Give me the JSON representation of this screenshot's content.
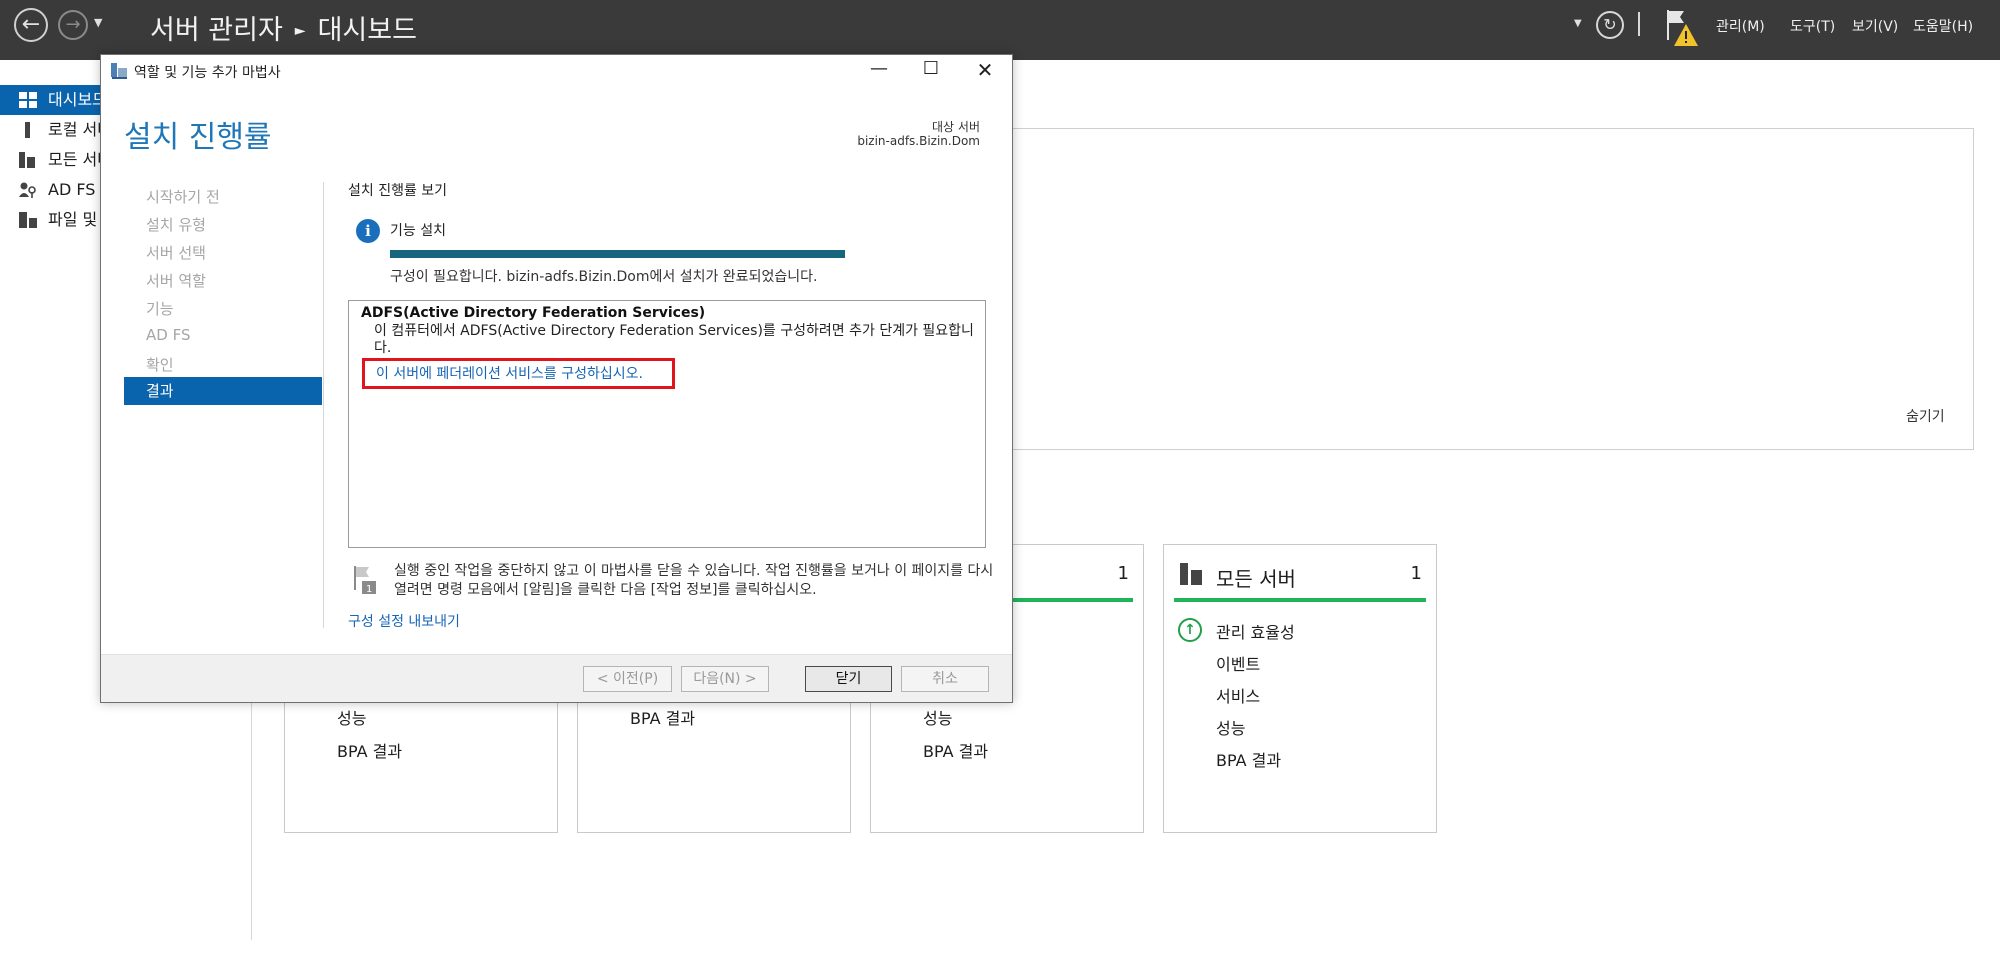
{
  "topbar": {
    "crumb_app": "서버 관리자",
    "crumb_page": "대시보드",
    "menus": [
      "관리(M)",
      "도구(T)",
      "보기(V)",
      "도움말(H)"
    ]
  },
  "leftnav": {
    "items": [
      {
        "label": "대시보드",
        "selected": true
      },
      {
        "label": "로컬 서버"
      },
      {
        "label": "모든 서버"
      },
      {
        "label": "AD FS"
      },
      {
        "label": "파일 및 저장소 서비스"
      }
    ]
  },
  "dashboard": {
    "hide_label": "숨기기",
    "tile3_count": "1",
    "tiles": [
      {
        "rows": [
          "성능",
          "BPA 결과"
        ]
      },
      {
        "rows": [
          "BPA 결과"
        ]
      },
      {
        "rows": [
          "성능",
          "BPA 결과"
        ]
      },
      {
        "title": "모든 서버",
        "count": "1",
        "rows": [
          "관리 효율성",
          "이벤트",
          "서비스",
          "성능",
          "BPA 결과"
        ]
      }
    ]
  },
  "dialog": {
    "title": "역할 및 기능 추가 마법사",
    "heading": "설치 진행률",
    "target_label": "대상 서버",
    "target_value": "bizin-adfs.Bizin.Dom",
    "steps": [
      "시작하기 전",
      "설치 유형",
      "서버 선택",
      "서버 역할",
      "기능",
      "AD FS",
      "확인",
      "결과"
    ],
    "view_label": "설치 진행률 보기",
    "feature_label": "기능 설치",
    "progress": 1.0,
    "status": "구성이 필요합니다. bizin-adfs.Bizin.Dom에서 설치가 완료되었습니다.",
    "result_title": "ADFS(Active Directory Federation Services)",
    "result_desc": "이 컴퓨터에서 ADFS(Active Directory Federation Services)를 구성하려면 추가 단계가 필요합니다.",
    "result_link": "이 서버에 페더레이션 서비스를 구성하십시오.",
    "note": "실행 중인 작업을 중단하지 않고 이 마법사를 닫을 수 있습니다. 작업 진행률을 보거나 이 페이지를 다시 열려면 명령 모음에서 [알림]을 클릭한 다음 [작업 정보]를 클릭하십시오.",
    "export_link": "구성 설정 내보내기",
    "buttons": {
      "prev": "< 이전(P)",
      "next": "다음(N) >",
      "close": "닫기",
      "cancel": "취소"
    }
  }
}
